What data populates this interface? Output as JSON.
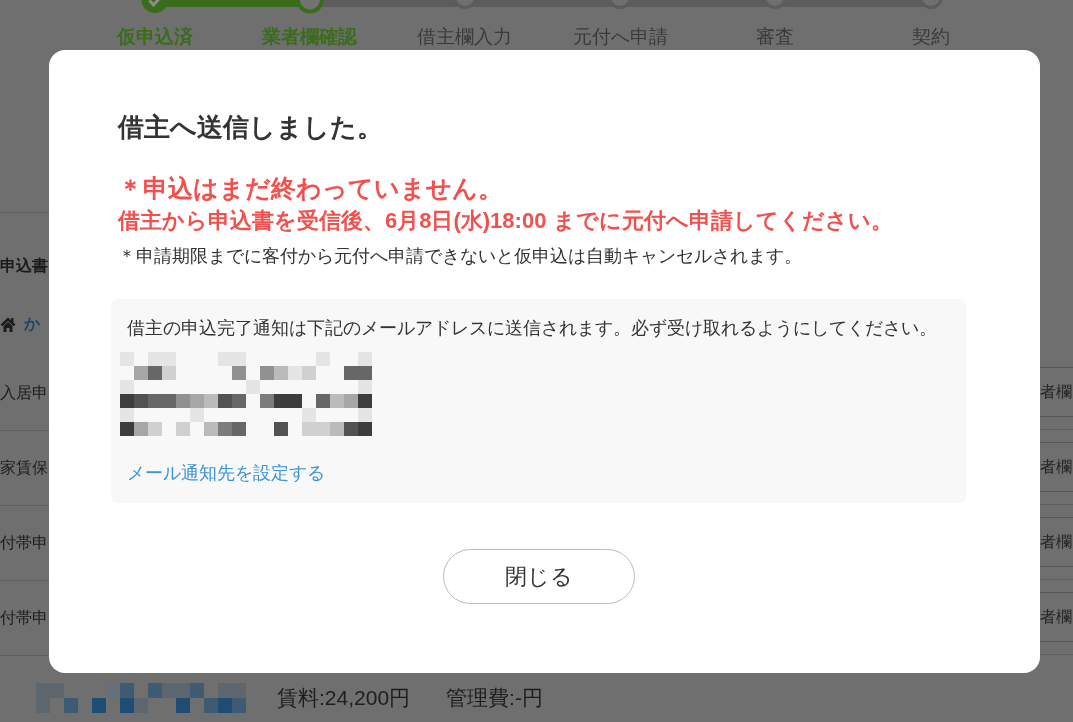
{
  "progress_steps": [
    {
      "label": "仮申込済",
      "completed": true,
      "current": false
    },
    {
      "label": "業者欄確認",
      "completed": false,
      "current": true
    },
    {
      "label": "借主欄入力",
      "completed": false,
      "current": false
    },
    {
      "label": "元付へ申請",
      "completed": false,
      "current": false
    },
    {
      "label": "審査",
      "completed": false,
      "current": false
    },
    {
      "label": "契約",
      "completed": false,
      "current": false
    }
  ],
  "background_page": {
    "section_title": "申込書",
    "property_link": "か",
    "rows": [
      {
        "label": "入居申",
        "button": "者欄"
      },
      {
        "label": "家賃保",
        "button": "者欄"
      },
      {
        "label": "付帯申",
        "button": "者欄"
      },
      {
        "label": "付帯申",
        "button": "者欄"
      }
    ],
    "rent": "賃料:24,200円",
    "management_fee": "管理費:-円"
  },
  "dialog": {
    "title": "借主へ送信しました。",
    "warning": "＊申込はまだ終わっていません。",
    "deadline": "借主から申込書を受信後、6月8日(水)18:00 までに元付へ申請してください。",
    "note": "＊申請期限までに客付から元付へ申請できないと仮申込は自動キャンセルされます。",
    "notice_box": {
      "message": "借主の申込完了通知は下記のメールアドレスに送信されます。必ず受け取れるようにしてください。",
      "link": "メール通知先を設定する"
    },
    "close_button": "閉じる"
  }
}
